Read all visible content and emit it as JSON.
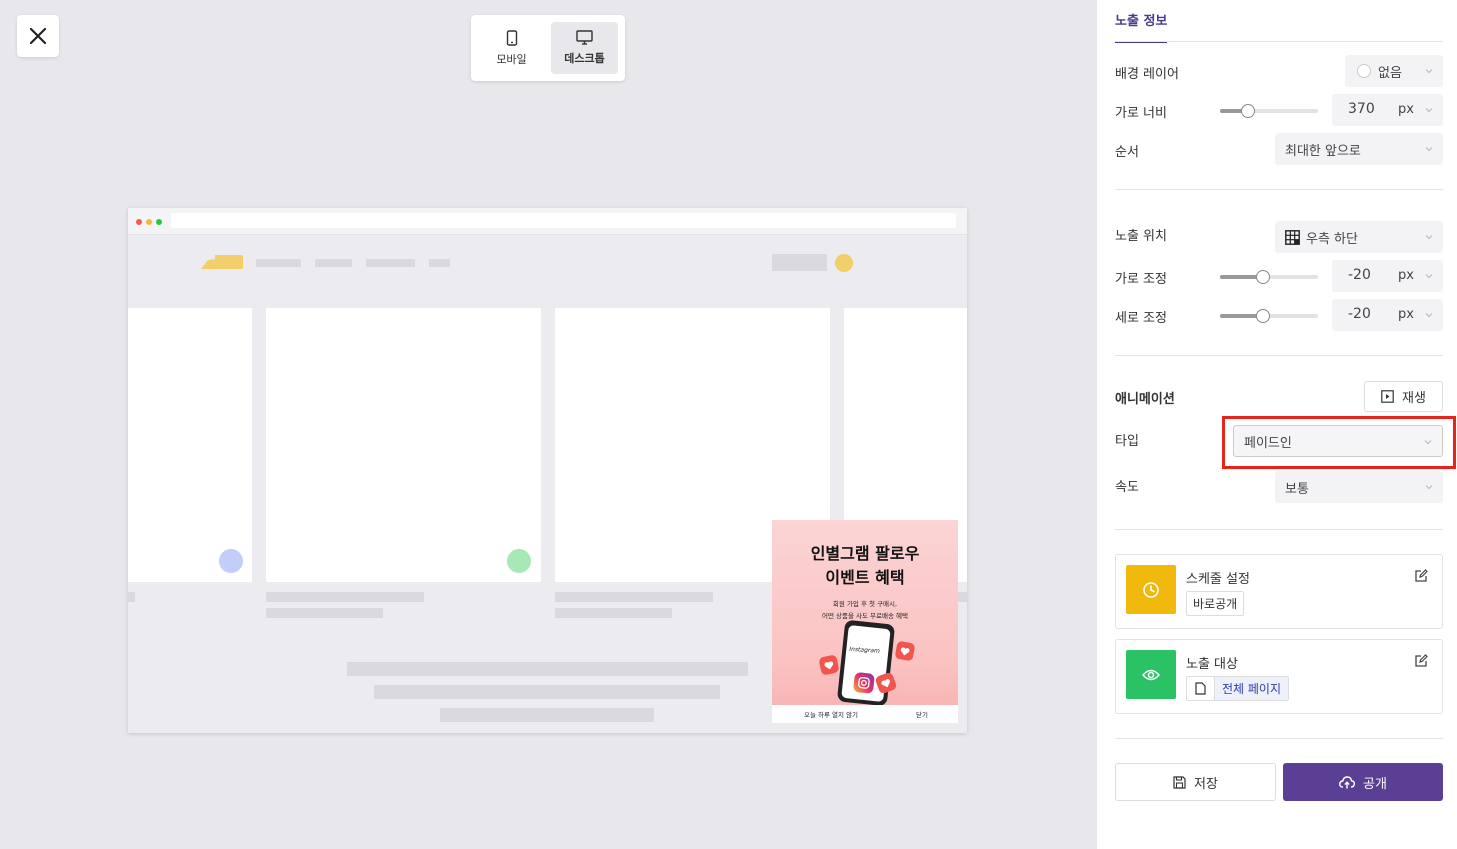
{
  "device_toggle": {
    "mobile_label": "모바일",
    "desktop_label": "데스크톱",
    "active": "desktop"
  },
  "popup": {
    "title_line1": "인별그램 팔로우",
    "title_line2": "이벤트 혜택",
    "subtitle_line1": "회원 가입 후 첫 구매시,",
    "subtitle_line2": "어떤 상품을 사도 무료배송 혜택",
    "phone_text": "Instagram",
    "dont_show_today": "오늘 하루 열지 않기",
    "close": "닫기"
  },
  "panel": {
    "tab": "노출 정보",
    "background_layer": {
      "label": "배경 레이어",
      "value": "없음"
    },
    "width": {
      "label": "가로 너비",
      "value": "370",
      "unit": "px",
      "level": 0.3
    },
    "order": {
      "label": "순서",
      "value": "최대한 앞으로"
    },
    "position": {
      "label": "노출 위치",
      "value": "우측 하단"
    },
    "offset_x": {
      "label": "가로 조정",
      "value": "-20",
      "unit": "px",
      "level": 0.45
    },
    "offset_y": {
      "label": "세로 조정",
      "value": "-20",
      "unit": "px",
      "level": 0.45
    },
    "animation": {
      "title": "애니메이션",
      "play_label": "재생",
      "type_label": "타입",
      "type_value": "페이드인",
      "speed_label": "속도",
      "speed_value": "보통"
    },
    "schedule": {
      "title": "스케줄 설정",
      "tag": "바로공개"
    },
    "target": {
      "title": "노출 대상",
      "tag": "전체 페이지"
    },
    "save_label": "저장",
    "publish_label": "공개"
  },
  "colors": {
    "accent": "#5a3f94",
    "highlight": "#e8231a",
    "schedule_icon_bg": "#f0b90b",
    "target_icon_bg": "#2bc266",
    "popup_bg": "#fbc8c8"
  }
}
